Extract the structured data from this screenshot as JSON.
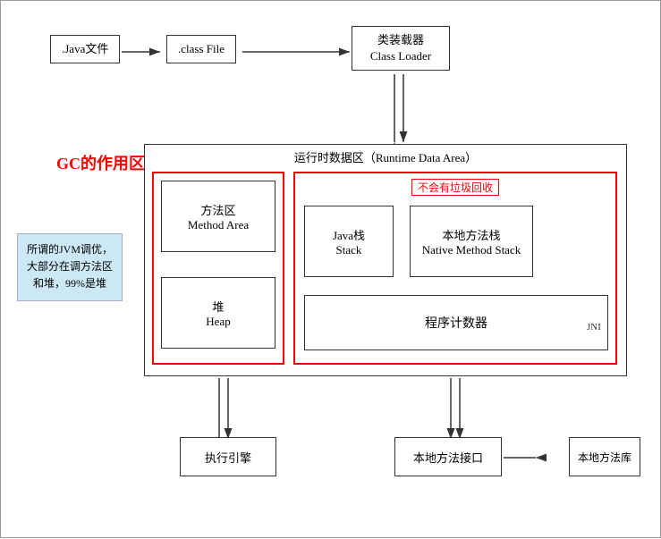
{
  "top": {
    "java_file_label": ".Java文件",
    "class_file_label": ".class File",
    "classloader_line1": "类装载器",
    "classloader_line2": "Class Loader"
  },
  "gc": {
    "label": "GC的作用区域"
  },
  "note": {
    "text": "所谓的JVM调优，大部分在调方法区和堆，99%是堆"
  },
  "runtime": {
    "label": "运行时数据区（Runtime Data Area）",
    "method_area_line1": "方法区",
    "method_area_line2": "Method Area",
    "heap_line1": "堆",
    "heap_line2": "Heap",
    "no_gc_label": "不会有垃圾回收",
    "java_stack_line1": "Java栈",
    "java_stack_line2": "Stack",
    "native_stack_line1": "本地方法栈",
    "native_stack_line2": "Native Method Stack",
    "program_counter": "程序计数器",
    "jni": "JNI"
  },
  "bottom": {
    "exec_engine": "执行引擎",
    "native_interface": "本地方法接口",
    "native_lib": "本地方法库"
  }
}
